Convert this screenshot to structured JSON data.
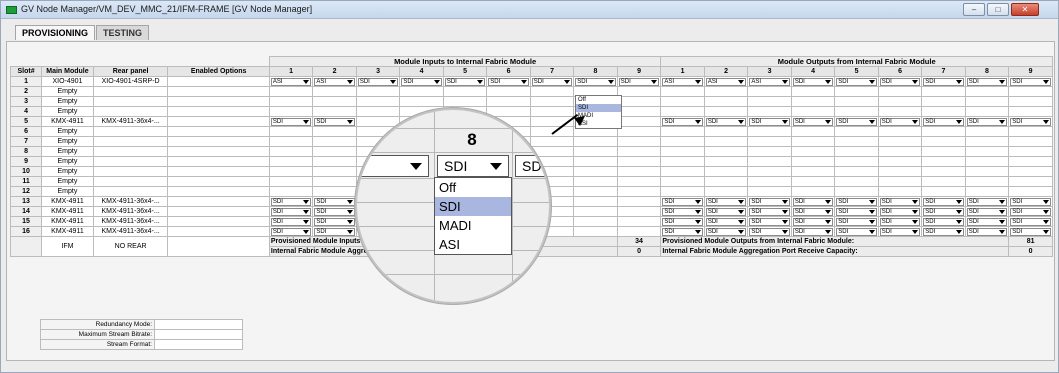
{
  "window": {
    "title": "GV Node Manager/VM_DEV_MMC_21/IFM-FRAME [GV Node Manager]",
    "minimize_label": "–",
    "maximize_label": "□",
    "close_label": "✕"
  },
  "tabs": [
    {
      "label": "PROVISIONING",
      "active": true
    },
    {
      "label": "TESTING",
      "active": false
    }
  ],
  "headers": {
    "inputs_group": "Module Inputs to Internal Fabric Module",
    "outputs_group": "Module Outputs from Internal Fabric Module",
    "slot": "Slot#",
    "main_module": "Main Module",
    "rear_panel": "Rear panel",
    "enabled_options": "Enabled Options",
    "ports": [
      "1",
      "2",
      "3",
      "4",
      "5",
      "6",
      "7",
      "8",
      "9"
    ]
  },
  "rows": [
    {
      "slot": "1",
      "main": "XIO-4901",
      "rear": "XIO-4901-4SRP-D",
      "options": "",
      "inputs": [
        "ASI",
        "ASI",
        "SDI",
        "SDI",
        "SDI",
        "SDI",
        "SDI",
        "SDI",
        "SDI"
      ],
      "outputs": [
        "ASI",
        "ASI",
        "ASI",
        "SDI",
        "SDI",
        "SDI",
        "SDI",
        "SDI",
        "SDI"
      ]
    },
    {
      "slot": "2",
      "main": "Empty",
      "rear": "",
      "options": "",
      "inputs": [
        "",
        "",
        "",
        "",
        "",
        "",
        "",
        "",
        ""
      ],
      "outputs": [
        "",
        "",
        "",
        "",
        "",
        "",
        "",
        "",
        ""
      ]
    },
    {
      "slot": "3",
      "main": "Empty",
      "rear": "",
      "options": "",
      "inputs": [
        "",
        "",
        "",
        "",
        "",
        "",
        "",
        "",
        ""
      ],
      "outputs": [
        "",
        "",
        "",
        "",
        "",
        "",
        "",
        "",
        ""
      ]
    },
    {
      "slot": "4",
      "main": "Empty",
      "rear": "",
      "options": "",
      "inputs": [
        "",
        "",
        "",
        "",
        "",
        "",
        "",
        "",
        ""
      ],
      "outputs": [
        "",
        "",
        "",
        "",
        "",
        "",
        "",
        "",
        ""
      ]
    },
    {
      "slot": "5",
      "main": "KMX-4911",
      "rear": "KMX-4911-36x4-...",
      "options": "",
      "inputs": [
        "SDI",
        "SDI",
        "",
        "",
        "",
        "",
        "",
        "",
        ""
      ],
      "outputs": [
        "SDI",
        "SDI",
        "SDI",
        "SDI",
        "SDI",
        "SDI",
        "SDI",
        "SDI",
        "SDI"
      ]
    },
    {
      "slot": "6",
      "main": "Empty",
      "rear": "",
      "options": "",
      "inputs": [
        "",
        "",
        "",
        "",
        "",
        "",
        "",
        "",
        ""
      ],
      "outputs": [
        "",
        "",
        "",
        "",
        "",
        "",
        "",
        "",
        ""
      ]
    },
    {
      "slot": "7",
      "main": "Empty",
      "rear": "",
      "options": "",
      "inputs": [
        "",
        "",
        "",
        "",
        "",
        "",
        "",
        "",
        ""
      ],
      "outputs": [
        "",
        "",
        "",
        "",
        "",
        "",
        "",
        "",
        ""
      ]
    },
    {
      "slot": "8",
      "main": "Empty",
      "rear": "",
      "options": "",
      "inputs": [
        "",
        "",
        "",
        "",
        "",
        "",
        "",
        "",
        ""
      ],
      "outputs": [
        "",
        "",
        "",
        "",
        "",
        "",
        "",
        "",
        ""
      ]
    },
    {
      "slot": "9",
      "main": "Empty",
      "rear": "",
      "options": "",
      "inputs": [
        "",
        "",
        "",
        "",
        "",
        "",
        "",
        "",
        ""
      ],
      "outputs": [
        "",
        "",
        "",
        "",
        "",
        "",
        "",
        "",
        ""
      ]
    },
    {
      "slot": "10",
      "main": "Empty",
      "rear": "",
      "options": "",
      "inputs": [
        "",
        "",
        "",
        "",
        "",
        "",
        "",
        "",
        ""
      ],
      "outputs": [
        "",
        "",
        "",
        "",
        "",
        "",
        "",
        "",
        ""
      ]
    },
    {
      "slot": "11",
      "main": "Empty",
      "rear": "",
      "options": "",
      "inputs": [
        "",
        "",
        "",
        "",
        "",
        "",
        "",
        "",
        ""
      ],
      "outputs": [
        "",
        "",
        "",
        "",
        "",
        "",
        "",
        "",
        ""
      ]
    },
    {
      "slot": "12",
      "main": "Empty",
      "rear": "",
      "options": "",
      "inputs": [
        "",
        "",
        "",
        "",
        "",
        "",
        "",
        "",
        ""
      ],
      "outputs": [
        "",
        "",
        "",
        "",
        "",
        "",
        "",
        "",
        ""
      ]
    },
    {
      "slot": "13",
      "main": "KMX-4911",
      "rear": "KMX-4911-36x4-...",
      "options": "",
      "inputs": [
        "SDI",
        "SDI",
        "",
        "",
        "",
        "",
        "",
        "",
        ""
      ],
      "outputs": [
        "SDI",
        "SDI",
        "SDI",
        "SDI",
        "SDI",
        "SDI",
        "SDI",
        "SDI",
        "SDI"
      ]
    },
    {
      "slot": "14",
      "main": "KMX-4911",
      "rear": "KMX-4911-36x4-...",
      "options": "",
      "inputs": [
        "SDI",
        "SDI",
        "",
        "",
        "",
        "",
        "",
        "",
        ""
      ],
      "outputs": [
        "SDI",
        "SDI",
        "SDI",
        "SDI",
        "SDI",
        "SDI",
        "SDI",
        "SDI",
        "SDI"
      ]
    },
    {
      "slot": "15",
      "main": "KMX-4911",
      "rear": "KMX-4911-36x4-...",
      "options": "",
      "inputs": [
        "SDI",
        "SDI",
        "",
        "",
        "",
        "",
        "",
        "",
        ""
      ],
      "outputs": [
        "SDI",
        "SDI",
        "SDI",
        "SDI",
        "SDI",
        "SDI",
        "SDI",
        "SDI",
        "SDI"
      ]
    },
    {
      "slot": "16",
      "main": "KMX-4911",
      "rear": "KMX-4911-36x4-...",
      "options": "",
      "inputs": [
        "SDI",
        "SDI",
        "",
        "",
        "",
        "",
        "",
        "",
        ""
      ],
      "outputs": [
        "SDI",
        "SDI",
        "SDI",
        "SDI",
        "SDI",
        "SDI",
        "SDI",
        "SDI",
        "SDI"
      ]
    }
  ],
  "ifm": {
    "main": "IFM",
    "rear": "NO REAR"
  },
  "summary": {
    "prov_inputs_label": "Provisioned Module Inputs to Internal Fabric Module:",
    "prov_inputs_value": "34",
    "transmit_label": "Internal Fabric Module Aggregation Port Transmit Capacity:",
    "transmit_value": "0",
    "prov_outputs_label": "Provisioned Module Outputs from Internal Fabric Module:",
    "prov_outputs_value": "81",
    "receive_label": "Internal Fabric Module Aggregation Port Receive Capacity:",
    "receive_value": "0"
  },
  "info": {
    "redundancy_label": "Redundancy Mode:",
    "bitrate_label": "Maximum Stream Bitrate:",
    "format_label": "Stream Format:"
  },
  "dropdown_options": [
    "Off",
    "SDI",
    "MADI",
    "ASI"
  ],
  "dropdown_highlighted": "SDI",
  "magnifier": {
    "column_label": "8",
    "selected_value": "SDI",
    "next_value": "SDI"
  }
}
